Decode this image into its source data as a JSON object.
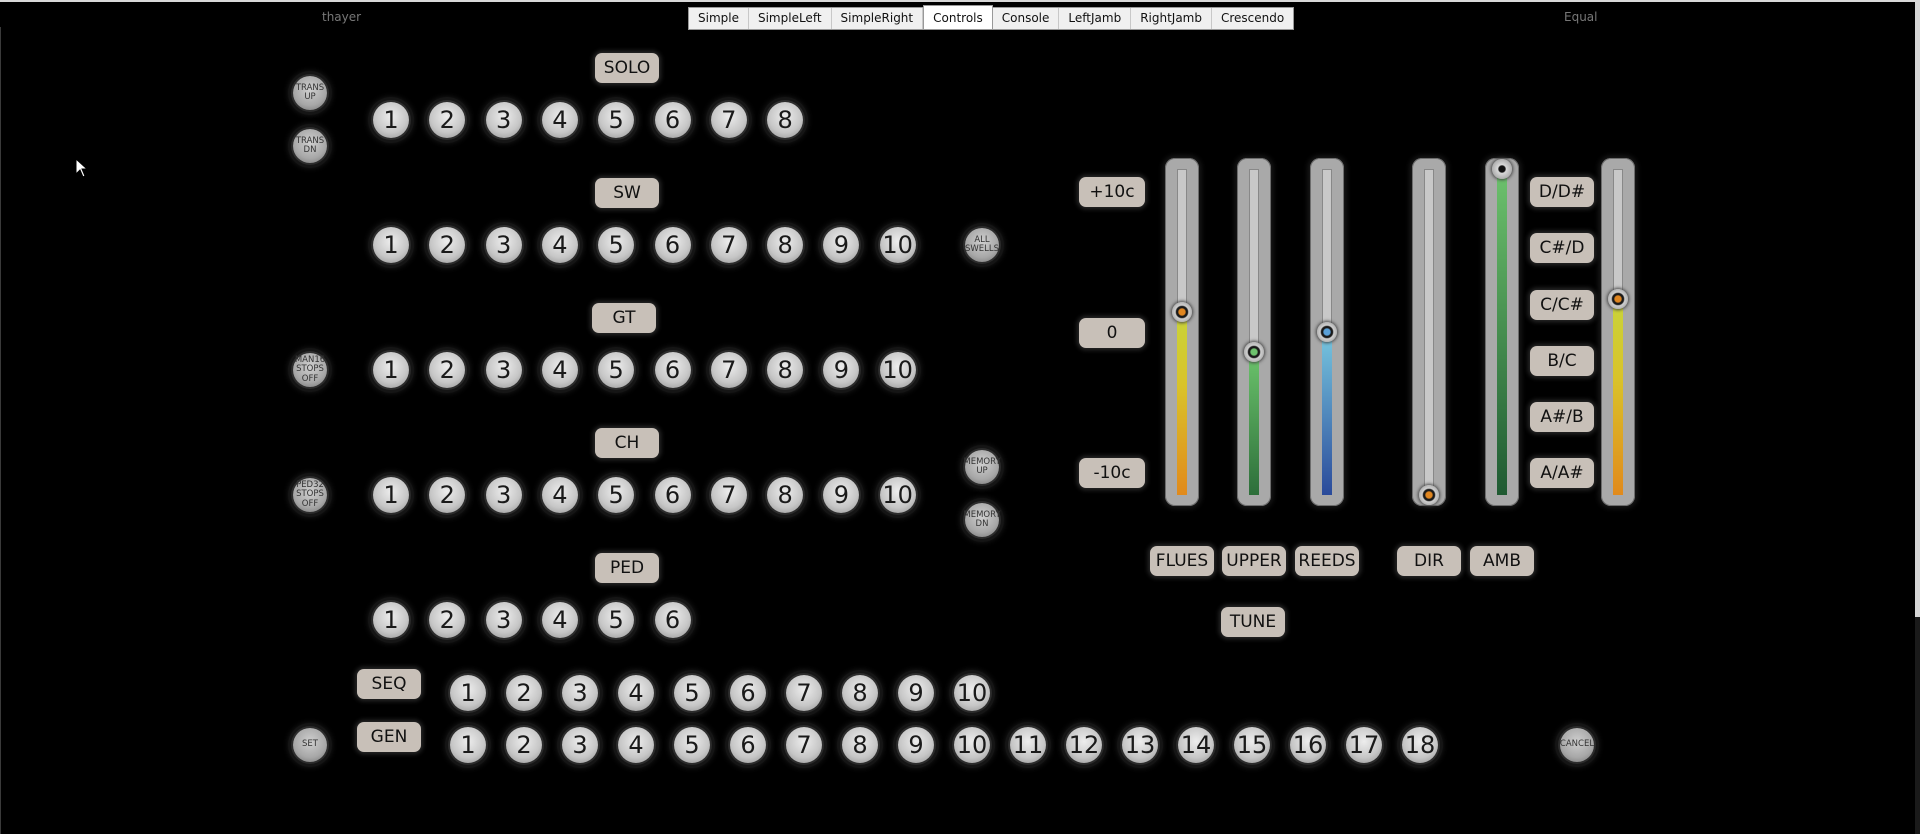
{
  "window": {
    "left_title": "thayer",
    "right_title": "Equal"
  },
  "tabs": [
    "Simple",
    "SimpleLeft",
    "SimpleRight",
    "Controls",
    "Console",
    "LeftJamb",
    "RightJamb",
    "Crescendo"
  ],
  "active_tab": "Controls",
  "side_buttons": {
    "trans_up": "TRANS UP",
    "trans_dn": "TRANS DN",
    "man16": "MAN16 STOPS OFF",
    "ped32": "PED32 STOPS OFF",
    "all_swells": "ALL SWELLS",
    "memory_up": "MEMORY UP",
    "memory_dn": "MEMORY DN",
    "set": "SET",
    "cancel": "CANCEL"
  },
  "divisions": [
    {
      "label": "SOLO",
      "count": 8
    },
    {
      "label": "SW",
      "count": 10
    },
    {
      "label": "GT",
      "count": 10
    },
    {
      "label": "CH",
      "count": 10
    },
    {
      "label": "PED",
      "count": 6
    }
  ],
  "sequence": {
    "label": "SEQ",
    "count": 10
  },
  "general": {
    "label": "GEN",
    "count": 18
  },
  "tuning_labels": [
    "+10c",
    "0",
    "-10c"
  ],
  "sliders": [
    {
      "name": "flues",
      "label": "FLUES",
      "level": 0.56,
      "color": "yellow"
    },
    {
      "name": "upper",
      "label": "UPPER",
      "level": 0.44,
      "color": "green"
    },
    {
      "name": "reeds",
      "label": "REEDS",
      "level": 0.5,
      "color": "blue"
    },
    {
      "name": "dir",
      "label": "DIR",
      "level": 0.0,
      "color": "none"
    },
    {
      "name": "amb",
      "label": "AMB",
      "level": 1.0,
      "color": "darkgreen"
    },
    {
      "name": "temper",
      "label": "",
      "level": 0.6,
      "color": "yellow"
    }
  ],
  "tune_label": "TUNE",
  "temperament_labels": [
    "D/D#",
    "C#/D",
    "C/C#",
    "B/C",
    "A#/B",
    "A/A#"
  ]
}
